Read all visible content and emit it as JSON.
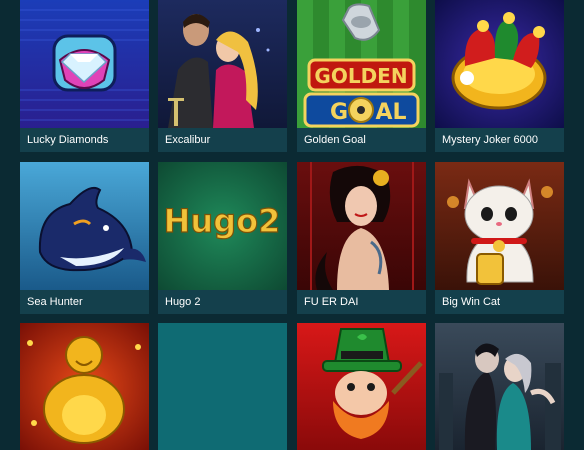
{
  "games": [
    {
      "title": "Lucky Diamonds",
      "icon": "diamond-icon"
    },
    {
      "title": "Excalibur",
      "icon": "knight-couple-icon"
    },
    {
      "title": "Golden Goal",
      "icon": "whistle-icon",
      "logo_lines": [
        "GOLDEN",
        "GOAL"
      ]
    },
    {
      "title": "Mystery Joker 6000",
      "icon": "jester-hat-icon"
    },
    {
      "title": "Sea Hunter",
      "icon": "orca-icon"
    },
    {
      "title": "Hugo 2",
      "icon": "hugo-logo",
      "logo": "Hugo2"
    },
    {
      "title": "FU ER DAI",
      "icon": "geisha-icon"
    },
    {
      "title": "Big Win Cat",
      "icon": "lucky-cat-icon"
    },
    {
      "title": "",
      "icon": "buddha-icon"
    },
    {
      "title": "",
      "icon": "blank-tile"
    },
    {
      "title": "",
      "icon": "leprechaun-icon"
    },
    {
      "title": "",
      "icon": "vampire-couple-icon"
    }
  ],
  "colors": {
    "background": "#0b2a33",
    "caption_bg": "#14404c",
    "caption_text": "#ffffff",
    "blank_tile": "#0f6b73"
  }
}
